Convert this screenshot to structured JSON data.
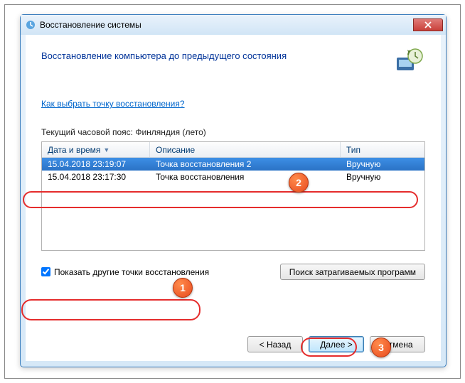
{
  "window": {
    "title": "Восстановление системы"
  },
  "heading": "Восстановление компьютера до предыдущего состояния",
  "link": "Как выбрать точку восстановления?",
  "timezone_label": "Текущий часовой пояс: Финляндия (лето)",
  "columns": {
    "date": "Дата и время",
    "desc": "Описание",
    "type": "Тип"
  },
  "rows": [
    {
      "date": "15.04.2018 23:19:07",
      "desc": "Точка восстановления 2",
      "type": "Вручную",
      "selected": true
    },
    {
      "date": "15.04.2018 23:17:30",
      "desc": "Точка восстановления",
      "type": "Вручную",
      "selected": false
    }
  ],
  "checkbox": {
    "label": "Показать другие точки восстановления",
    "checked": true
  },
  "scan_button": "Поиск затрагиваемых программ",
  "footer": {
    "back": "< Назад",
    "next": "Далее >",
    "cancel": "Отмена"
  },
  "annotations": {
    "n1": "1",
    "n2": "2",
    "n3": "3"
  }
}
